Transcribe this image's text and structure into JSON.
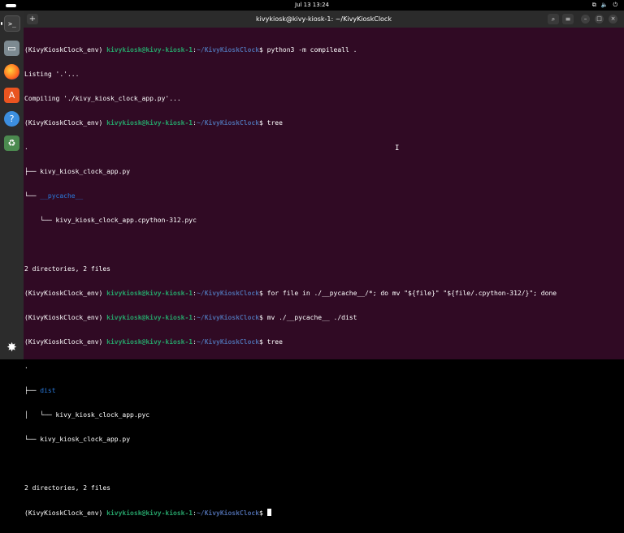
{
  "topbar": {
    "datetime": "Jul 13  13:24",
    "tray_network": "⧉",
    "tray_sound": "🔈",
    "tray_power": "⏻"
  },
  "dock": {
    "items": [
      "terminal",
      "files",
      "firefox",
      "app-center",
      "help",
      "trash"
    ],
    "terminal_glyph": ">_",
    "files_glyph": "▭",
    "appcenter_glyph": "A",
    "help_glyph": "?",
    "trash_glyph": "♻",
    "apps_glyph": "✸"
  },
  "window": {
    "title": "kivykiosk@kivy-kiosk-1: ~/KivyKioskClock",
    "new_tab_glyph": "+",
    "search_glyph": "⌕",
    "menu_glyph": "≡",
    "min_glyph": "–",
    "max_glyph": "□",
    "close_glyph": "×"
  },
  "prompt": {
    "env": "(KivyKioskClock_env) ",
    "user": "kivykiosk@kivy-kiosk-1",
    "sep": ":",
    "path": "~/KivyKioskClock",
    "dollar": "$ "
  },
  "terminal": {
    "cmd1": "python3 -m compileall .",
    "out1": "Listing '.'...",
    "out2": "Compiling './kivy_kiosk_clock_app.py'...",
    "cmd2": "tree",
    "tree1_root": ".",
    "tree1_l1": "├── kivy_kiosk_clock_app.py",
    "tree1_l2_prefix": "└── ",
    "tree1_l2_dir": "__pycache__",
    "tree1_l3": "    └── kivy_kiosk_clock_app.cpython-312.pyc",
    "summary1": "2 directories, 2 files",
    "cmd3": "for file in ./__pycache__/*; do mv \"${file}\" \"${file/.cpython-312/}\"; done",
    "cmd4": "mv ./__pycache__ ./dist",
    "cmd5": "tree",
    "tree2_root": ".",
    "tree2_l1_prefix": "├── ",
    "tree2_l1_dir": "dist",
    "tree2_l2": "│   └── kivy_kiosk_clock_app.pyc",
    "tree2_l3": "└── kivy_kiosk_clock_app.py",
    "summary2": "2 directories, 2 files"
  }
}
